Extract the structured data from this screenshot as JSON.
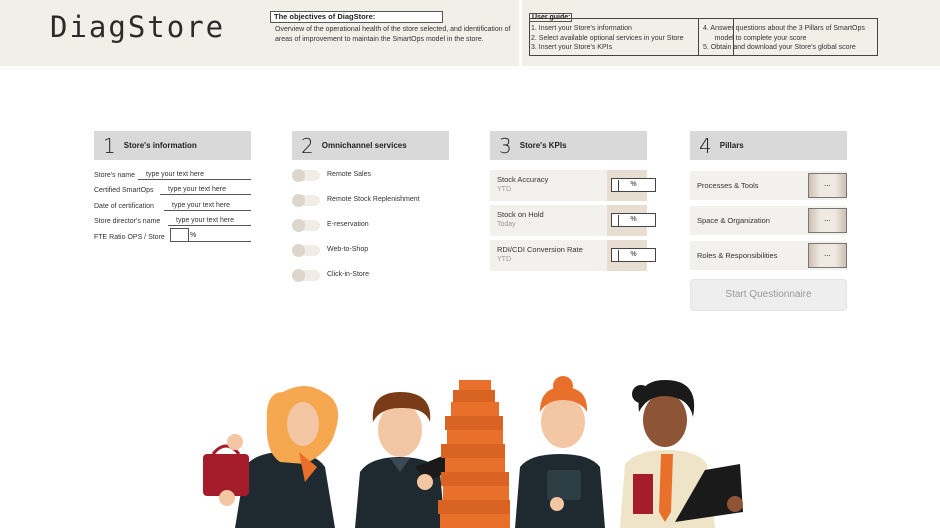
{
  "app": {
    "title": "DiagStore"
  },
  "objectives": {
    "title": "The objectives of DiagStore:",
    "text": "Overview of the operational health of the store selected, and identification of areas of improvement to maintain the SmartOps model in the store."
  },
  "guide": {
    "title": "User guide:",
    "left": [
      "1.   Insert your Store's information",
      "2.   Select available optional services in your Store",
      "3.   Insert your Store's KPIs"
    ],
    "right": [
      "4.   Answer questions about the 3 Pillars of SmartOps",
      "      model to complete your score",
      "5.   Obtain and download your Store's global score"
    ]
  },
  "sections": [
    {
      "num": "1",
      "title": "Store's information"
    },
    {
      "num": "2",
      "title": "Omnichannel services"
    },
    {
      "num": "3",
      "title": "Store's KPIs"
    },
    {
      "num": "4",
      "title": "Pillars"
    }
  ],
  "store_info": {
    "fields": [
      {
        "label": "Store's name",
        "value": "type your text here"
      },
      {
        "label": "Certified SmartOps",
        "value": "type your text here"
      },
      {
        "label": "Date of certification",
        "value": "type your text here"
      },
      {
        "label": "Store director's name",
        "value": "type your text here"
      }
    ],
    "fte_label": "FTE Ratio OPS / Store",
    "fte_unit": "%"
  },
  "services": [
    "Remote Sales",
    "Remote Stock Replenishment",
    "E-reservation",
    "Web-to-Shop",
    "Click-in-Store"
  ],
  "kpis": [
    {
      "name": "Stock Accuracy",
      "sub": "YTD",
      "unit": "%"
    },
    {
      "name": "Stock on Hold",
      "sub": "Today",
      "unit": "%"
    },
    {
      "name": "RDI/CDI Conversion Rate",
      "sub": "YTD",
      "unit": "%"
    }
  ],
  "pillars": [
    {
      "name": "Processes & Tools",
      "btn": "..."
    },
    {
      "name": "Space & Organization",
      "btn": "..."
    },
    {
      "name": "Roles & Responsibilities",
      "btn": "..."
    }
  ],
  "start_button": "Start Questionnaire",
  "colors": {
    "header_bg": "#f2efe9",
    "section_bg": "#d9d9d9",
    "accent_orange": "#e8702a",
    "dark_navy": "#1f2a30"
  }
}
